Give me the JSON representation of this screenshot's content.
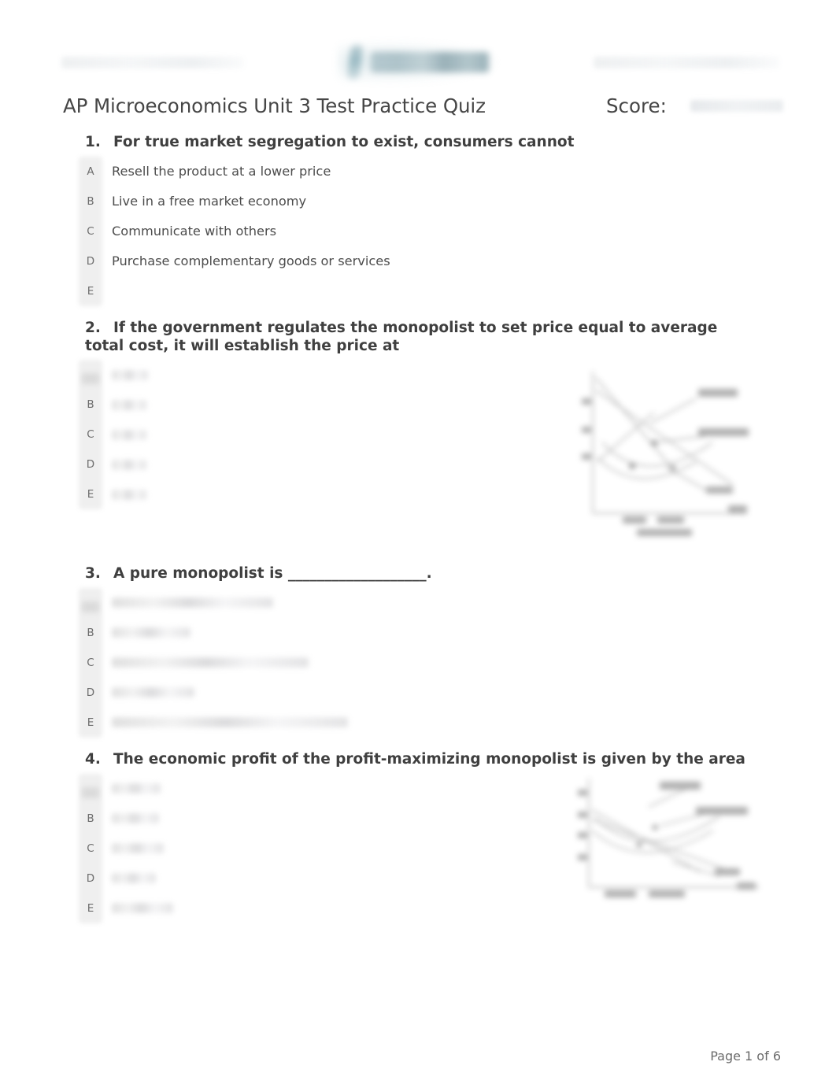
{
  "document": {
    "title": "AP Microeconomics Unit 3 Test Practice Quiz",
    "score_label": "Score:",
    "score_value": "",
    "footer": "Page 1 of 6"
  },
  "header": {
    "left_field": "",
    "right_field": "",
    "logo_name": "quizizz-logo"
  },
  "questions": [
    {
      "number": "1.",
      "text": "For true market segregation to exist, consumers cannot",
      "redacted": false,
      "has_figure": false,
      "options": [
        {
          "letter": "A",
          "text": "Resell the product at a lower price",
          "redacted": false,
          "letter_redacted": false,
          "blur_width": 0
        },
        {
          "letter": "B",
          "text": "Live in a free market economy",
          "redacted": false,
          "letter_redacted": false,
          "blur_width": 0
        },
        {
          "letter": "C",
          "text": "Communicate with others",
          "redacted": false,
          "letter_redacted": false,
          "blur_width": 0
        },
        {
          "letter": "D",
          "text": "Purchase complementary goods or services",
          "redacted": false,
          "letter_redacted": false,
          "blur_width": 0
        },
        {
          "letter": "E",
          "text": "",
          "redacted": false,
          "letter_redacted": false,
          "blur_width": 0
        }
      ]
    },
    {
      "number": "2.",
      "text": "If the government regulates the monopolist to set price equal to average total cost, it will establish the price at",
      "redacted": false,
      "has_figure": true,
      "figure_name": "monopoly-regulation-graph",
      "options": [
        {
          "letter": "A",
          "text": "",
          "redacted": true,
          "letter_redacted": true,
          "blur_width": 46
        },
        {
          "letter": "B",
          "text": "",
          "redacted": true,
          "letter_redacted": false,
          "blur_width": 44
        },
        {
          "letter": "C",
          "text": "",
          "redacted": true,
          "letter_redacted": false,
          "blur_width": 44
        },
        {
          "letter": "D",
          "text": "",
          "redacted": true,
          "letter_redacted": false,
          "blur_width": 44
        },
        {
          "letter": "E",
          "text": "",
          "redacted": true,
          "letter_redacted": false,
          "blur_width": 44
        }
      ]
    },
    {
      "number": "3.",
      "text": "A pure monopolist is ___________________.",
      "redacted": false,
      "has_figure": false,
      "options": [
        {
          "letter": "A",
          "text": "",
          "redacted": true,
          "letter_redacted": true,
          "blur_width": 205
        },
        {
          "letter": "B",
          "text": "",
          "redacted": true,
          "letter_redacted": false,
          "blur_width": 100
        },
        {
          "letter": "C",
          "text": "",
          "redacted": true,
          "letter_redacted": false,
          "blur_width": 250
        },
        {
          "letter": "D",
          "text": "",
          "redacted": true,
          "letter_redacted": false,
          "blur_width": 105
        },
        {
          "letter": "E",
          "text": "",
          "redacted": true,
          "letter_redacted": false,
          "blur_width": 300
        }
      ]
    },
    {
      "number": "4.",
      "text": "The economic profit of the profit-maximizing monopolist is given by the area",
      "redacted": false,
      "has_figure": true,
      "figure_name": "monopoly-profit-area-graph",
      "options": [
        {
          "letter": "A",
          "text": "",
          "redacted": true,
          "letter_redacted": true,
          "blur_width": 62
        },
        {
          "letter": "B",
          "text": "",
          "redacted": true,
          "letter_redacted": false,
          "blur_width": 60
        },
        {
          "letter": "C",
          "text": "",
          "redacted": true,
          "letter_redacted": false,
          "blur_width": 66
        },
        {
          "letter": "D",
          "text": "",
          "redacted": true,
          "letter_redacted": false,
          "blur_width": 56
        },
        {
          "letter": "E",
          "text": "",
          "redacted": true,
          "letter_redacted": false,
          "blur_width": 78
        }
      ]
    }
  ],
  "colors": {
    "text": "#4a4a4a",
    "question_text": "#3f3f3f",
    "letter": "#6d6d6d",
    "letter_chip_bg": "#e5e5e5",
    "page_bg": "#ffffff",
    "logo_teal": "#8fb3bd"
  }
}
